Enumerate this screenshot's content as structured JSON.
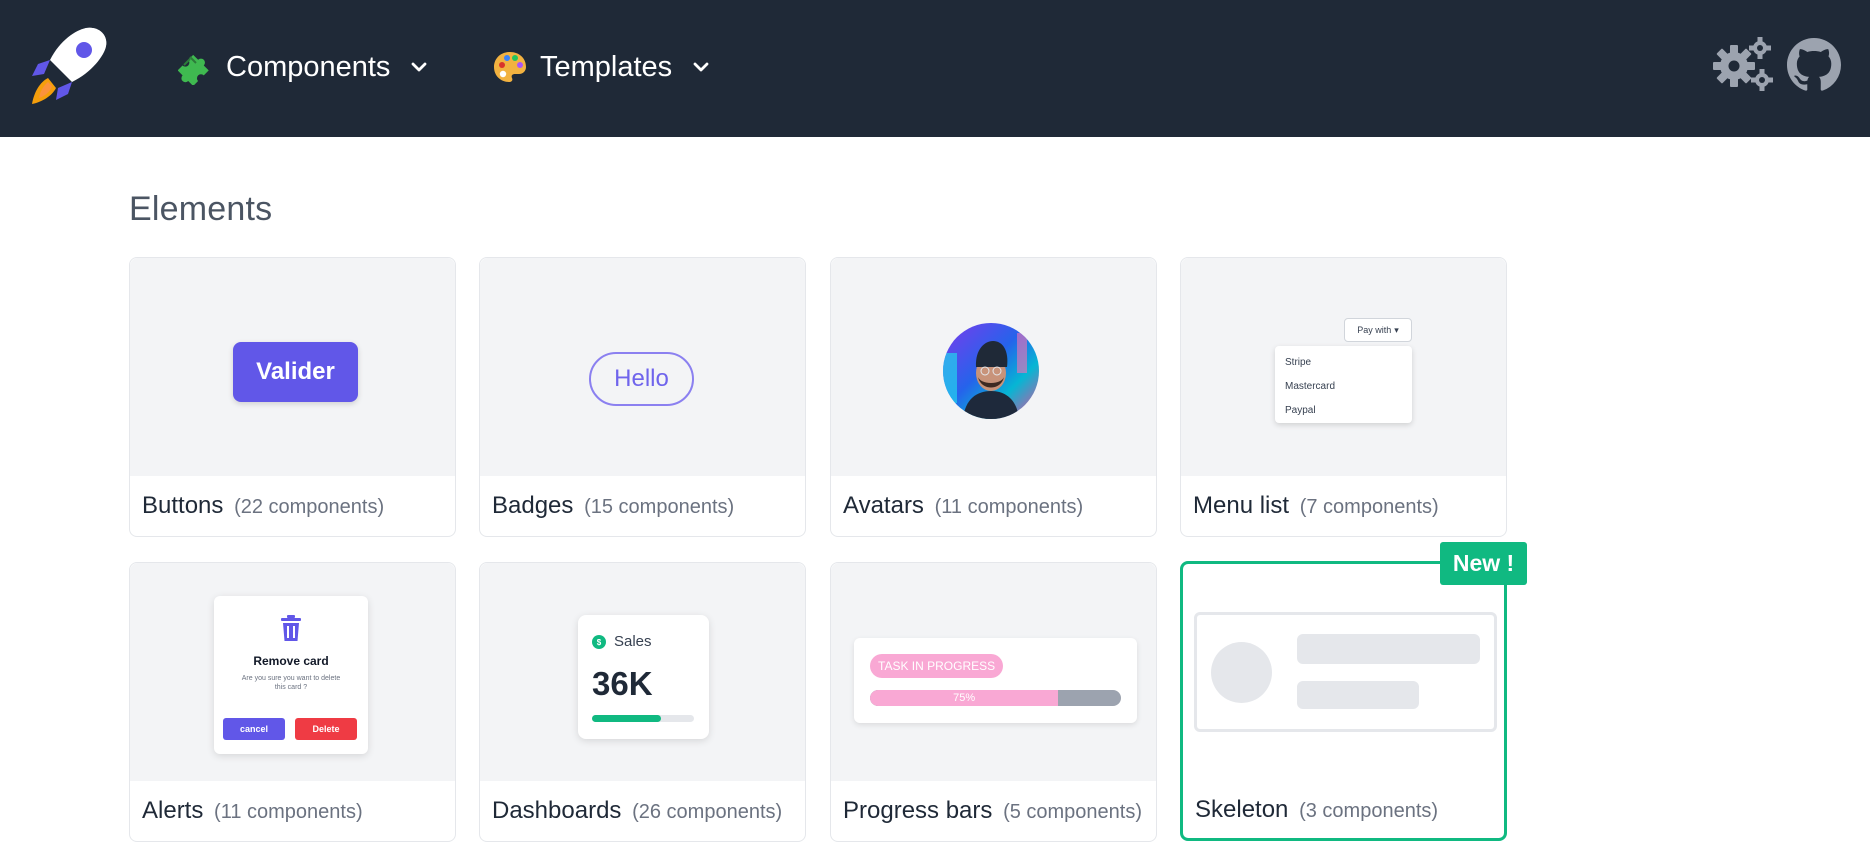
{
  "header": {
    "nav": [
      {
        "label": "Components",
        "icon": "puzzle-icon"
      },
      {
        "label": "Templates",
        "icon": "palette-icon"
      }
    ],
    "actions": [
      {
        "icon": "gear-icon"
      },
      {
        "icon": "github-icon"
      }
    ]
  },
  "section": {
    "title": "Elements"
  },
  "cards": [
    {
      "title": "Buttons",
      "count": "(22 components)",
      "preview": {
        "button_label": "Valider"
      }
    },
    {
      "title": "Badges",
      "count": "(15 components)",
      "preview": {
        "badge_label": "Hello"
      }
    },
    {
      "title": "Avatars",
      "count": "(11 components)"
    },
    {
      "title": "Menu list",
      "count": "(7 components)",
      "preview": {
        "trigger": "Pay with",
        "items": [
          "Stripe",
          "Mastercard",
          "Paypal"
        ]
      }
    },
    {
      "title": "Alerts",
      "count": "(11 components)",
      "preview": {
        "title": "Remove card",
        "text": "Are you sure you want to delete this card ?",
        "cancel": "cancel",
        "confirm": "Delete"
      }
    },
    {
      "title": "Dashboards",
      "count": "(26 components)",
      "preview": {
        "label": "Sales",
        "value": "36K",
        "progress": 0.68
      }
    },
    {
      "title": "Progress bars",
      "count": "(5 components)",
      "preview": {
        "tag": "TASK IN PROGRESS",
        "percent_label": "75%",
        "progress": 0.75
      }
    },
    {
      "title": "Skeleton",
      "count": "(3 components)",
      "badge": "New !"
    }
  ],
  "colors": {
    "header_bg": "#1f2937",
    "accent": "#6157e8",
    "success": "#10b981",
    "danger": "#ef3b44",
    "pink": "#f9a8d4"
  }
}
